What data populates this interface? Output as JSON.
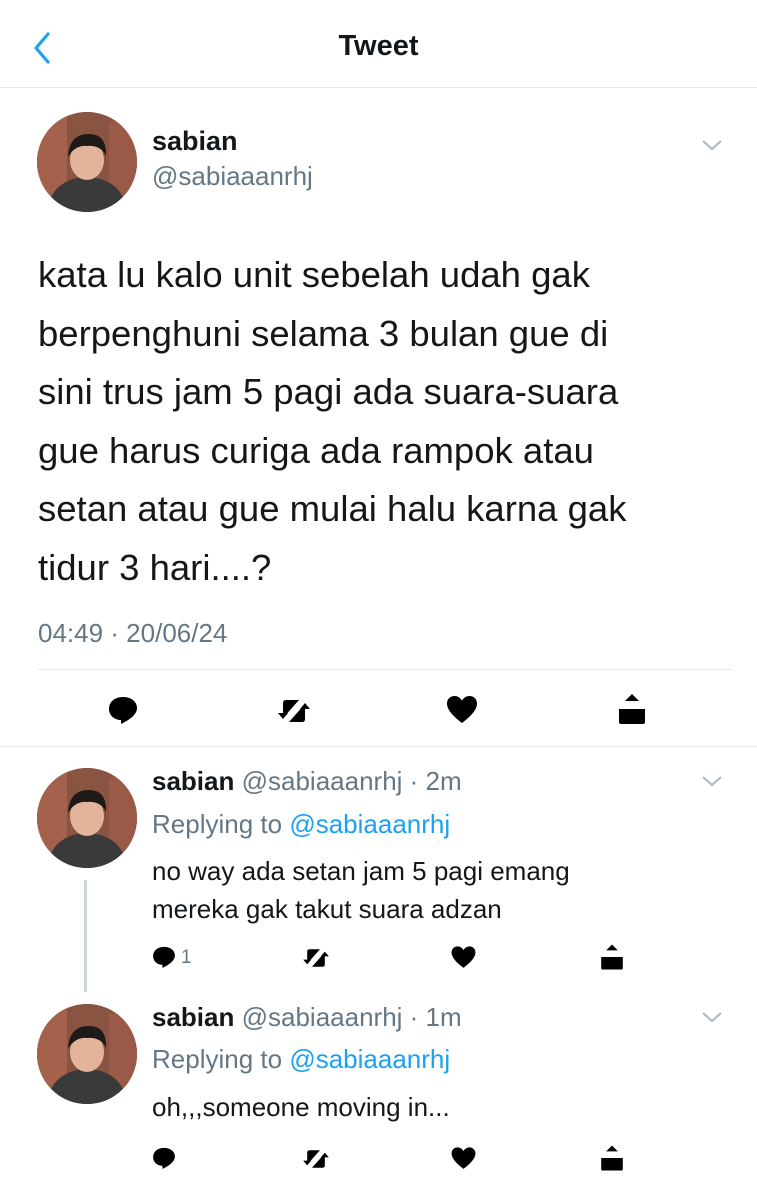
{
  "header": {
    "title": "Tweet"
  },
  "main_tweet": {
    "name": "sabian",
    "handle": "@sabiaaanrhj",
    "text_lines": [
      "kata lu kalo unit sebelah udah gak",
      "berpenghuni selama 3 bulan gue di",
      "sini trus jam 5 pagi ada suara-suara",
      "gue harus curiga ada rampok atau",
      "setan atau gue mulai halu karna gak",
      "tidur 3 hari....?"
    ],
    "timestamp": "04:49 · 20/06/24"
  },
  "replies": [
    {
      "name": "sabian",
      "handle_time": "@sabiaaanrhj · 2m",
      "replying_label": "Replying to",
      "replying_to": "@sabiaaanrhj",
      "text_lines": [
        "no way ada setan jam 5 pagi emang",
        "mereka gak takut suara adzan"
      ],
      "reply_count": "1"
    },
    {
      "name": "sabian",
      "handle_time": "@sabiaaanrhj · 1m",
      "replying_label": "Replying to",
      "replying_to": "@sabiaaanrhj",
      "text_lines": [
        "oh,,,someone moving in..."
      ],
      "reply_count": ""
    }
  ],
  "icons": {
    "back": "chevron-left-icon",
    "more": "chevron-down-icon",
    "reply": "reply-icon",
    "retweet": "retweet-icon",
    "like": "heart-icon",
    "share": "share-icon"
  },
  "colors": {
    "accent": "#1da1f2",
    "secondary_text": "#657786",
    "border": "#e1e8ed"
  }
}
